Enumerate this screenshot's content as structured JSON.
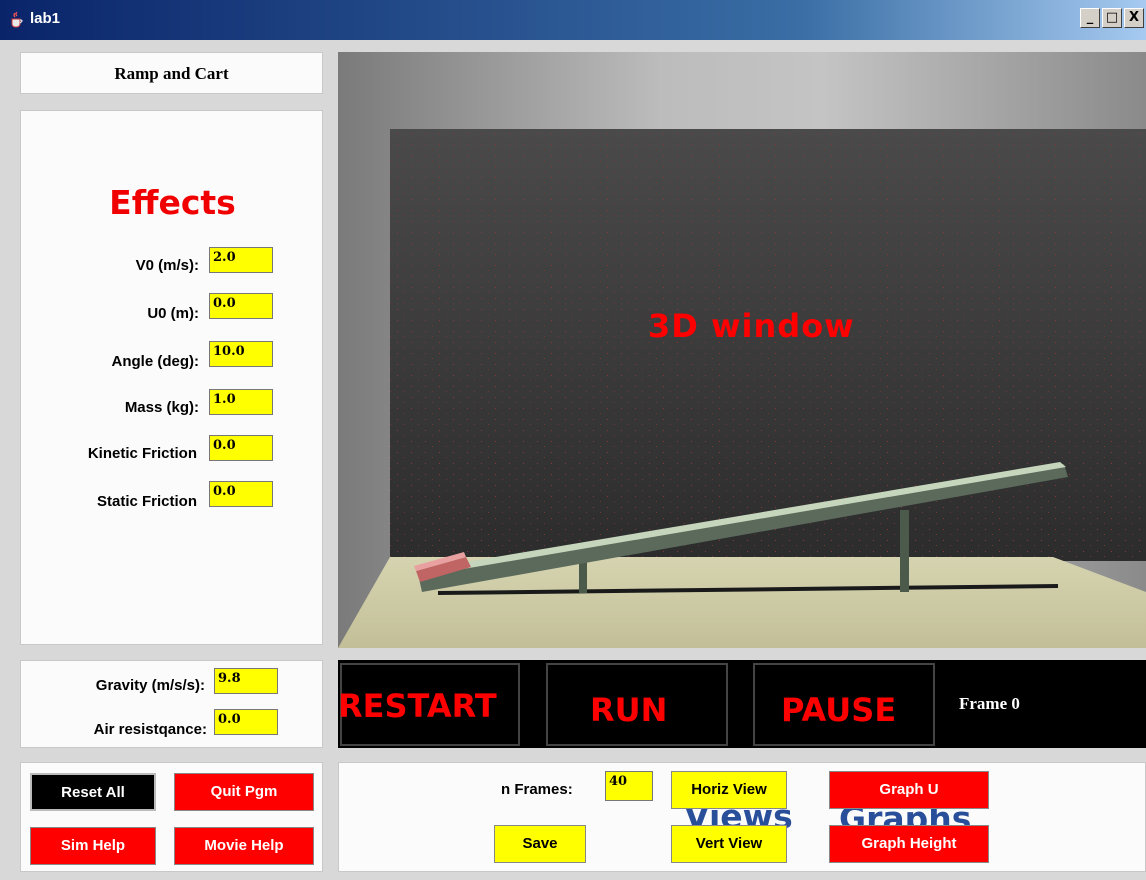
{
  "window": {
    "title": "lab1",
    "controls": [
      "_",
      "□",
      "X"
    ]
  },
  "header": {
    "title": "Ramp and Cart"
  },
  "effects": {
    "heading": "Effects",
    "params": [
      {
        "label": "V0 (m/s):",
        "value": "2.0"
      },
      {
        "label": "U0 (m):",
        "value": "0.0"
      },
      {
        "label": "Angle (deg):",
        "value": "10.0"
      },
      {
        "label": "Mass (kg):",
        "value": "1.0"
      },
      {
        "label": "Kinetic Friction",
        "value": "0.0"
      },
      {
        "label": "Static Friction",
        "value": "0.0"
      }
    ]
  },
  "environment": {
    "gravity_label": "Gravity (m/s/s):",
    "gravity_value": "9.8",
    "air_label": "Air resistqance:",
    "air_value": "0.0"
  },
  "viewport": {
    "label": "3D window"
  },
  "controls": {
    "restart": "RESTART",
    "run": "RUN",
    "pause": "PAUSE",
    "frame": "Frame 0"
  },
  "buttons": {
    "reset_all": "Reset All",
    "quit": "Quit Pgm",
    "sim_help": "Sim Help",
    "movie_help": "Movie Help"
  },
  "bottom": {
    "nframes_label": "n Frames:",
    "nframes_value": "40",
    "save": "Save",
    "horiz_view": "Horiz View",
    "vert_view": "Vert View",
    "graph_u": "Graph U",
    "graph_height": "Graph Height",
    "views_label": "Views",
    "graphs_label": "Graphs"
  },
  "colors": {
    "accent_red": "#ff0000",
    "field_yellow": "#ffff00",
    "label_blue": "#2a4f9a",
    "titlebar": "#0a246a"
  },
  "icons": {
    "app": "java-cup-icon",
    "minimize": "minimize-icon",
    "maximize": "maximize-icon",
    "close": "close-icon"
  }
}
